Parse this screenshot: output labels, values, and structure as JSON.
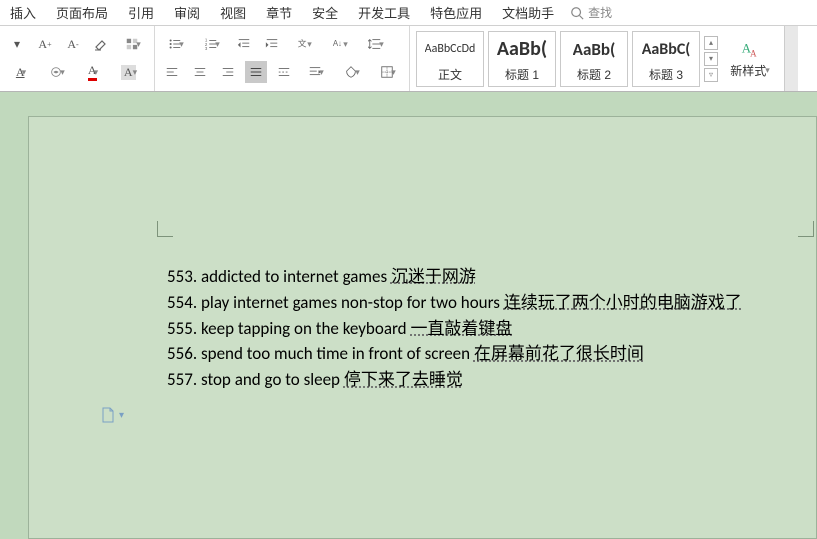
{
  "menu": {
    "items": [
      "插入",
      "页面布局",
      "引用",
      "审阅",
      "视图",
      "章节",
      "安全",
      "开发工具",
      "特色应用",
      "文档助手"
    ],
    "search_label": "查找"
  },
  "styles": {
    "items": [
      {
        "preview": "AaBbCcDd",
        "label": "正文",
        "size": "12px",
        "weight": "normal"
      },
      {
        "preview": "AaBb(",
        "label": "标题 1",
        "size": "20px",
        "weight": "bold"
      },
      {
        "preview": "AaBb(",
        "label": "标题 2",
        "size": "17px",
        "weight": "bold"
      },
      {
        "preview": "AaBbC(",
        "label": "标题 3",
        "size": "16px",
        "weight": "bold"
      }
    ],
    "new_style": "新样式"
  },
  "document": {
    "lines": [
      {
        "num": "553",
        "en": "addicted to internet games",
        "cn": "沉迷于网游"
      },
      {
        "num": "554",
        "en": "play internet games non-stop for two hours",
        "cn": "连续玩了两个小时的电脑游戏了"
      },
      {
        "num": "555",
        "en": "keep tapping on the keyboard",
        "cn": "一直敲着键盘"
      },
      {
        "num": "556",
        "en": "spend too much time in front of screen",
        "cn": "在屏幕前花了很长时间"
      },
      {
        "num": "557",
        "en": "stop and go to sleep",
        "cn": "停下来了去睡觉"
      }
    ]
  }
}
